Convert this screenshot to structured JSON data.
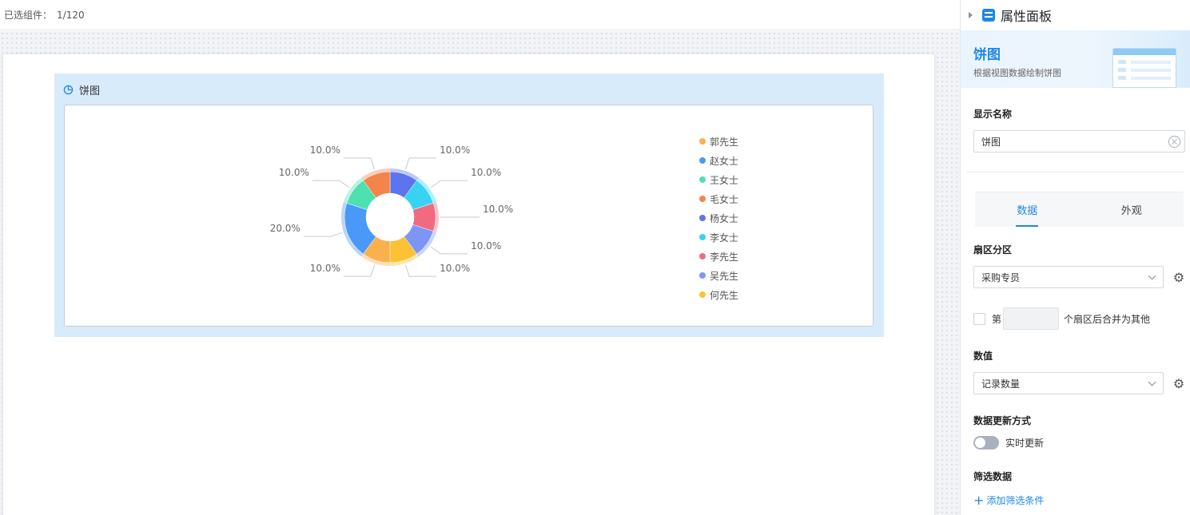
{
  "topbar": {
    "label": "已选组件：",
    "count": "1/120"
  },
  "widget": {
    "title": "饼图",
    "icon": "pie-chart-icon"
  },
  "chart_data": {
    "type": "pie",
    "donut": true,
    "categories": [
      "郭先生",
      "赵女士",
      "王女士",
      "毛女士",
      "杨女士",
      "李女士",
      "李先生",
      "吴先生",
      "何先生"
    ],
    "values": [
      10,
      20,
      10,
      10,
      10,
      10,
      10,
      10,
      10
    ],
    "labels": [
      "10.0%",
      "20.0%",
      "10.0%",
      "10.0%",
      "10.0%",
      "10.0%",
      "10.0%",
      "10.0%",
      "10.0%"
    ],
    "colors": [
      "#fbb04e",
      "#4a98f7",
      "#4ee0b0",
      "#f2844c",
      "#5d74f0",
      "#38d3f2",
      "#f06a80",
      "#7d95f5",
      "#fcc134"
    ],
    "legend_position": "right"
  },
  "panel": {
    "title": "属性面板",
    "banner_title": "饼图",
    "banner_subtitle": "根据视图数据绘制饼图",
    "display_name_label": "显示名称",
    "display_name_value": "饼图",
    "tabs": [
      "数据",
      "外观"
    ],
    "active_tab": "数据",
    "sector_label": "扇区分区",
    "sector_value": "采购专员",
    "merge_prefix": "第",
    "merge_suffix": "个扇区后合并为其他",
    "value_label": "数值",
    "value_value": "记录数量",
    "update_label": "数据更新方式",
    "realtime_label": "实时更新",
    "realtime_on": false,
    "filter_label": "筛选数据",
    "add_filter_label": "添加筛选条件"
  }
}
